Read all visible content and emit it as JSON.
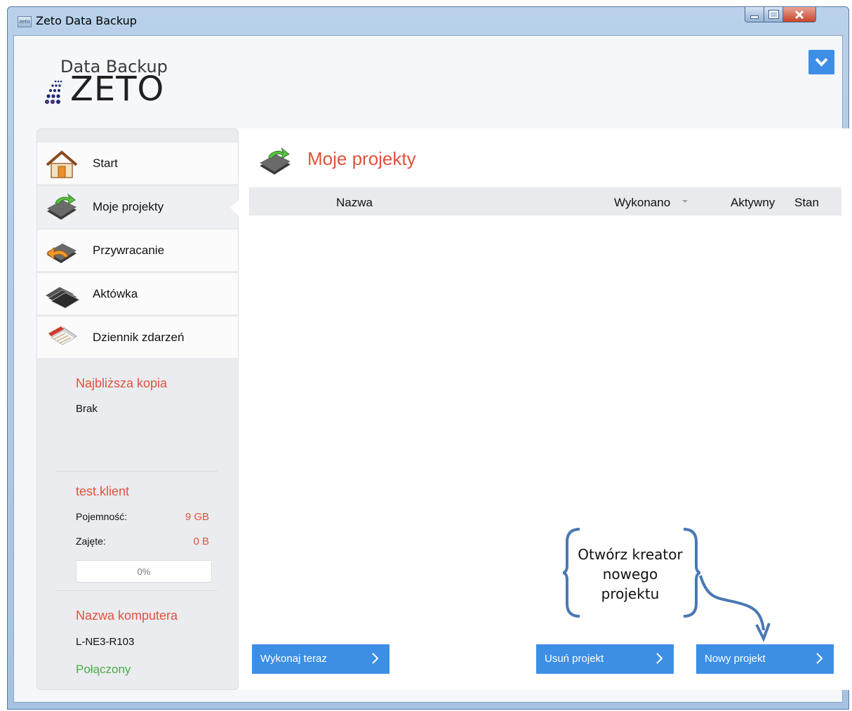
{
  "window": {
    "title": "Zeto Data Backup",
    "app_icon_text": "zeto",
    "accent_color": "#3d8fe6",
    "heading_color": "#e0523e",
    "ok_color": "#4caa47"
  },
  "logo": {
    "small": "Data Backup",
    "big": "ZETO"
  },
  "sidebar": {
    "items": [
      {
        "label": "Start",
        "icon": "home-icon"
      },
      {
        "label": "Moje projekty",
        "icon": "projects-icon"
      },
      {
        "label": "Przywracanie",
        "icon": "restore-icon"
      },
      {
        "label": "Aktówka",
        "icon": "briefcase-icon"
      },
      {
        "label": "Dziennik zdarzeń",
        "icon": "log-icon"
      }
    ],
    "next_backup": {
      "heading": "Najbliższa kopia",
      "value": "Brak"
    },
    "account": {
      "heading": "test.klient",
      "capacity_label": "Pojemność:",
      "capacity_value": "9 GB",
      "used_label": "Zajęte:",
      "used_value": "0 B",
      "progress_text": "0%",
      "progress_fraction": 0
    },
    "computer": {
      "heading": "Nazwa komputera",
      "value": "L-NE3-R103",
      "status": "Połączony"
    }
  },
  "main": {
    "title": "Moje projekty",
    "columns": {
      "name": "Nazwa",
      "done": "Wykonano",
      "active": "Aktywny",
      "state": "Stan"
    },
    "rows": []
  },
  "buttons": {
    "run_now": "Wykonaj teraz",
    "delete_project": "Usuń projekt",
    "new_project": "Nowy projekt"
  },
  "annotation": {
    "line1": "Otwórz kreator",
    "line2": "nowego",
    "line3": "projektu"
  }
}
